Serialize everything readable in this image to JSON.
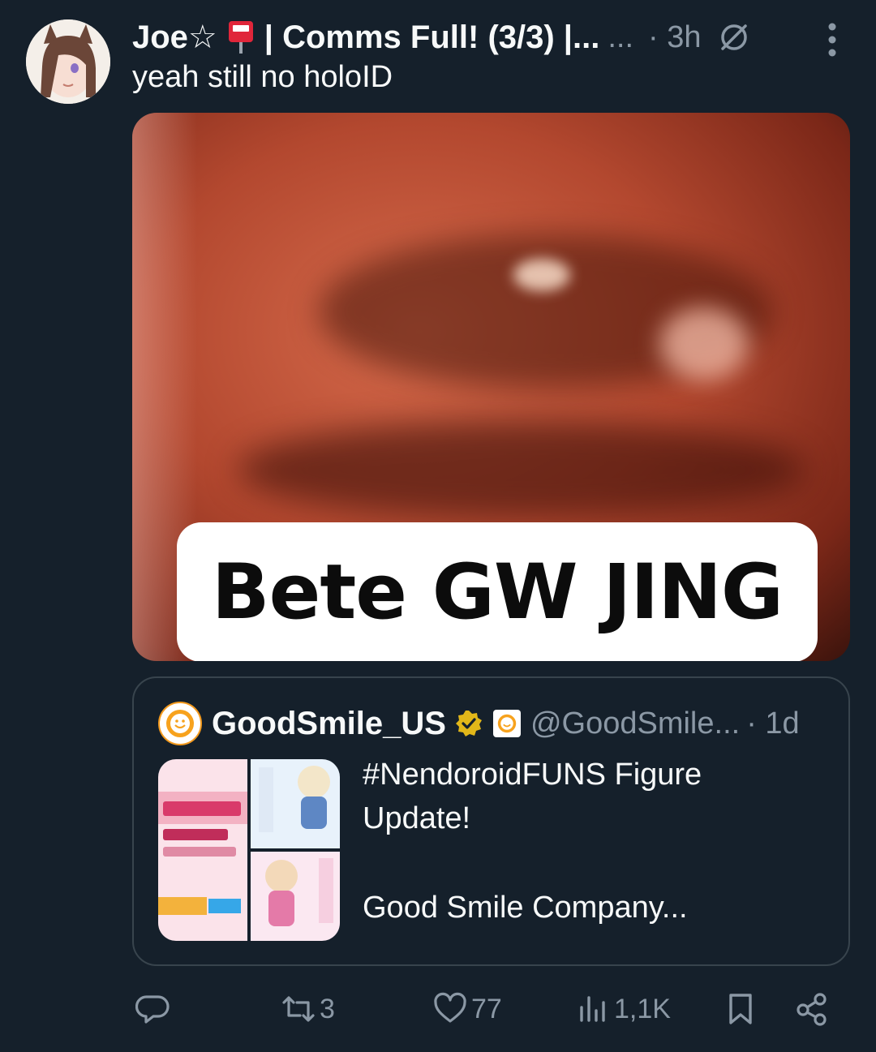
{
  "post": {
    "author": {
      "display_name": "Joe☆",
      "name_suffix": "| Comms Full! (3/3) |...",
      "ellipsis": "...",
      "timestamp": "· 3h"
    },
    "text": "yeah still no holoID",
    "media": {
      "caption": "Bete GW JING"
    },
    "quote": {
      "display_name": "GoodSmile_US",
      "handle": "@GoodSmile...",
      "timestamp": "· 1d",
      "text_line1": "#NendoroidFUNS Figure",
      "text_line2": "Update!",
      "text_line3": "Good Smile Company..."
    },
    "actions": {
      "reply_count": "",
      "repost_count": "3",
      "like_count": "77",
      "views_count": "1,1K"
    }
  },
  "icons": {
    "reply": "reply-icon",
    "repost": "repost-icon",
    "like": "heart-icon",
    "views": "views-icon",
    "bookmark": "bookmark-icon",
    "share": "share-icon",
    "more": "more-icon",
    "grok": "slash-circle-icon"
  },
  "colors": {
    "background": "#15202b",
    "text": "#f7f9f9",
    "muted": "#8b98a5",
    "border": "#38444d",
    "verified_gold": "#e2b719"
  }
}
